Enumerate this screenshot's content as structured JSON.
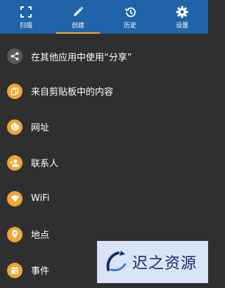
{
  "colors": {
    "tabbar": "#1f64a8",
    "tab_indicator": "#f1b13b",
    "background": "#2f2f2f",
    "share_badge": "#5b5b5b",
    "item_badge": "#f1a533"
  },
  "tabs": [
    {
      "label": "扫描",
      "icon": "scan-frame-icon"
    },
    {
      "label": "创建",
      "icon": "pencil-icon",
      "active": true
    },
    {
      "label": "历史",
      "icon": "history-icon"
    },
    {
      "label": "设置",
      "icon": "gear-icon"
    }
  ],
  "items": [
    {
      "label": "在其他应用中使用“分享”",
      "icon": "share-icon"
    },
    {
      "label": "来自剪贴板中的内容",
      "icon": "clipboard-icon"
    },
    {
      "label": "网址",
      "icon": "globe-icon"
    },
    {
      "label": "联系人",
      "icon": "contact-icon"
    },
    {
      "label": "WiFi",
      "icon": "wifi-icon"
    },
    {
      "label": "地点",
      "icon": "location-pin-icon"
    },
    {
      "label": "事件",
      "icon": "calendar-icon"
    }
  ],
  "watermark": {
    "text": "迟之资源"
  }
}
